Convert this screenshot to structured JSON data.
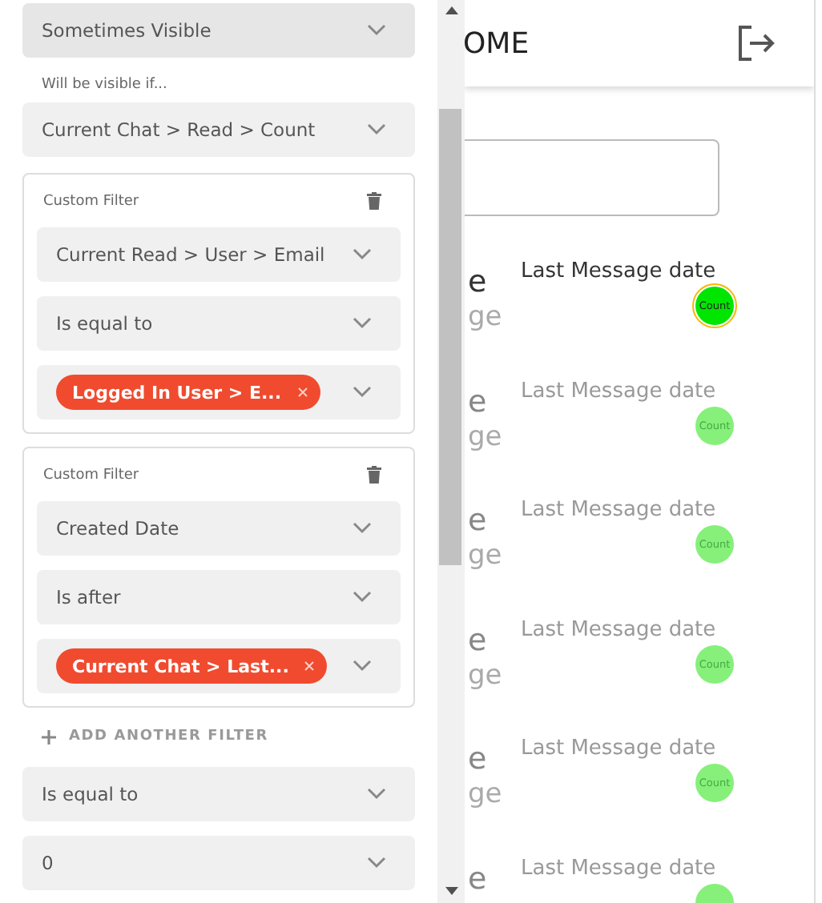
{
  "panel": {
    "visibility": "Sometimes Visible",
    "condition_label": "Will be visible if...",
    "condition_source": "Current Chat > Read > Count",
    "filters": [
      {
        "title": "Custom Filter",
        "field": "Current Read > User > Email",
        "operator": "Is equal to",
        "value_chip": "Logged In User > E..."
      },
      {
        "title": "Custom Filter",
        "field": "Created Date",
        "operator": "Is after",
        "value_chip": "Current Chat > Last..."
      }
    ],
    "add_filter": "ADD ANOTHER FILTER",
    "operator": "Is equal to",
    "compare_value": "0"
  },
  "preview": {
    "header_title": "OME",
    "rows": [
      {
        "name_fragment": "e",
        "subtitle_fragment": "ge",
        "date": "Last Message date",
        "count": "Count",
        "selected": true
      },
      {
        "name_fragment": "e",
        "subtitle_fragment": "ge",
        "date": "Last Message date",
        "count": "Count",
        "selected": false
      },
      {
        "name_fragment": "e",
        "subtitle_fragment": "ge",
        "date": "Last Message date",
        "count": "Count",
        "selected": false
      },
      {
        "name_fragment": "e",
        "subtitle_fragment": "ge",
        "date": "Last Message date",
        "count": "Count",
        "selected": false
      },
      {
        "name_fragment": "e",
        "subtitle_fragment": "ge",
        "date": "Last Message date",
        "count": "Count",
        "selected": false
      },
      {
        "name_fragment": "e",
        "subtitle_fragment": "",
        "date": "Last Message date",
        "count": "",
        "selected": false
      }
    ]
  }
}
